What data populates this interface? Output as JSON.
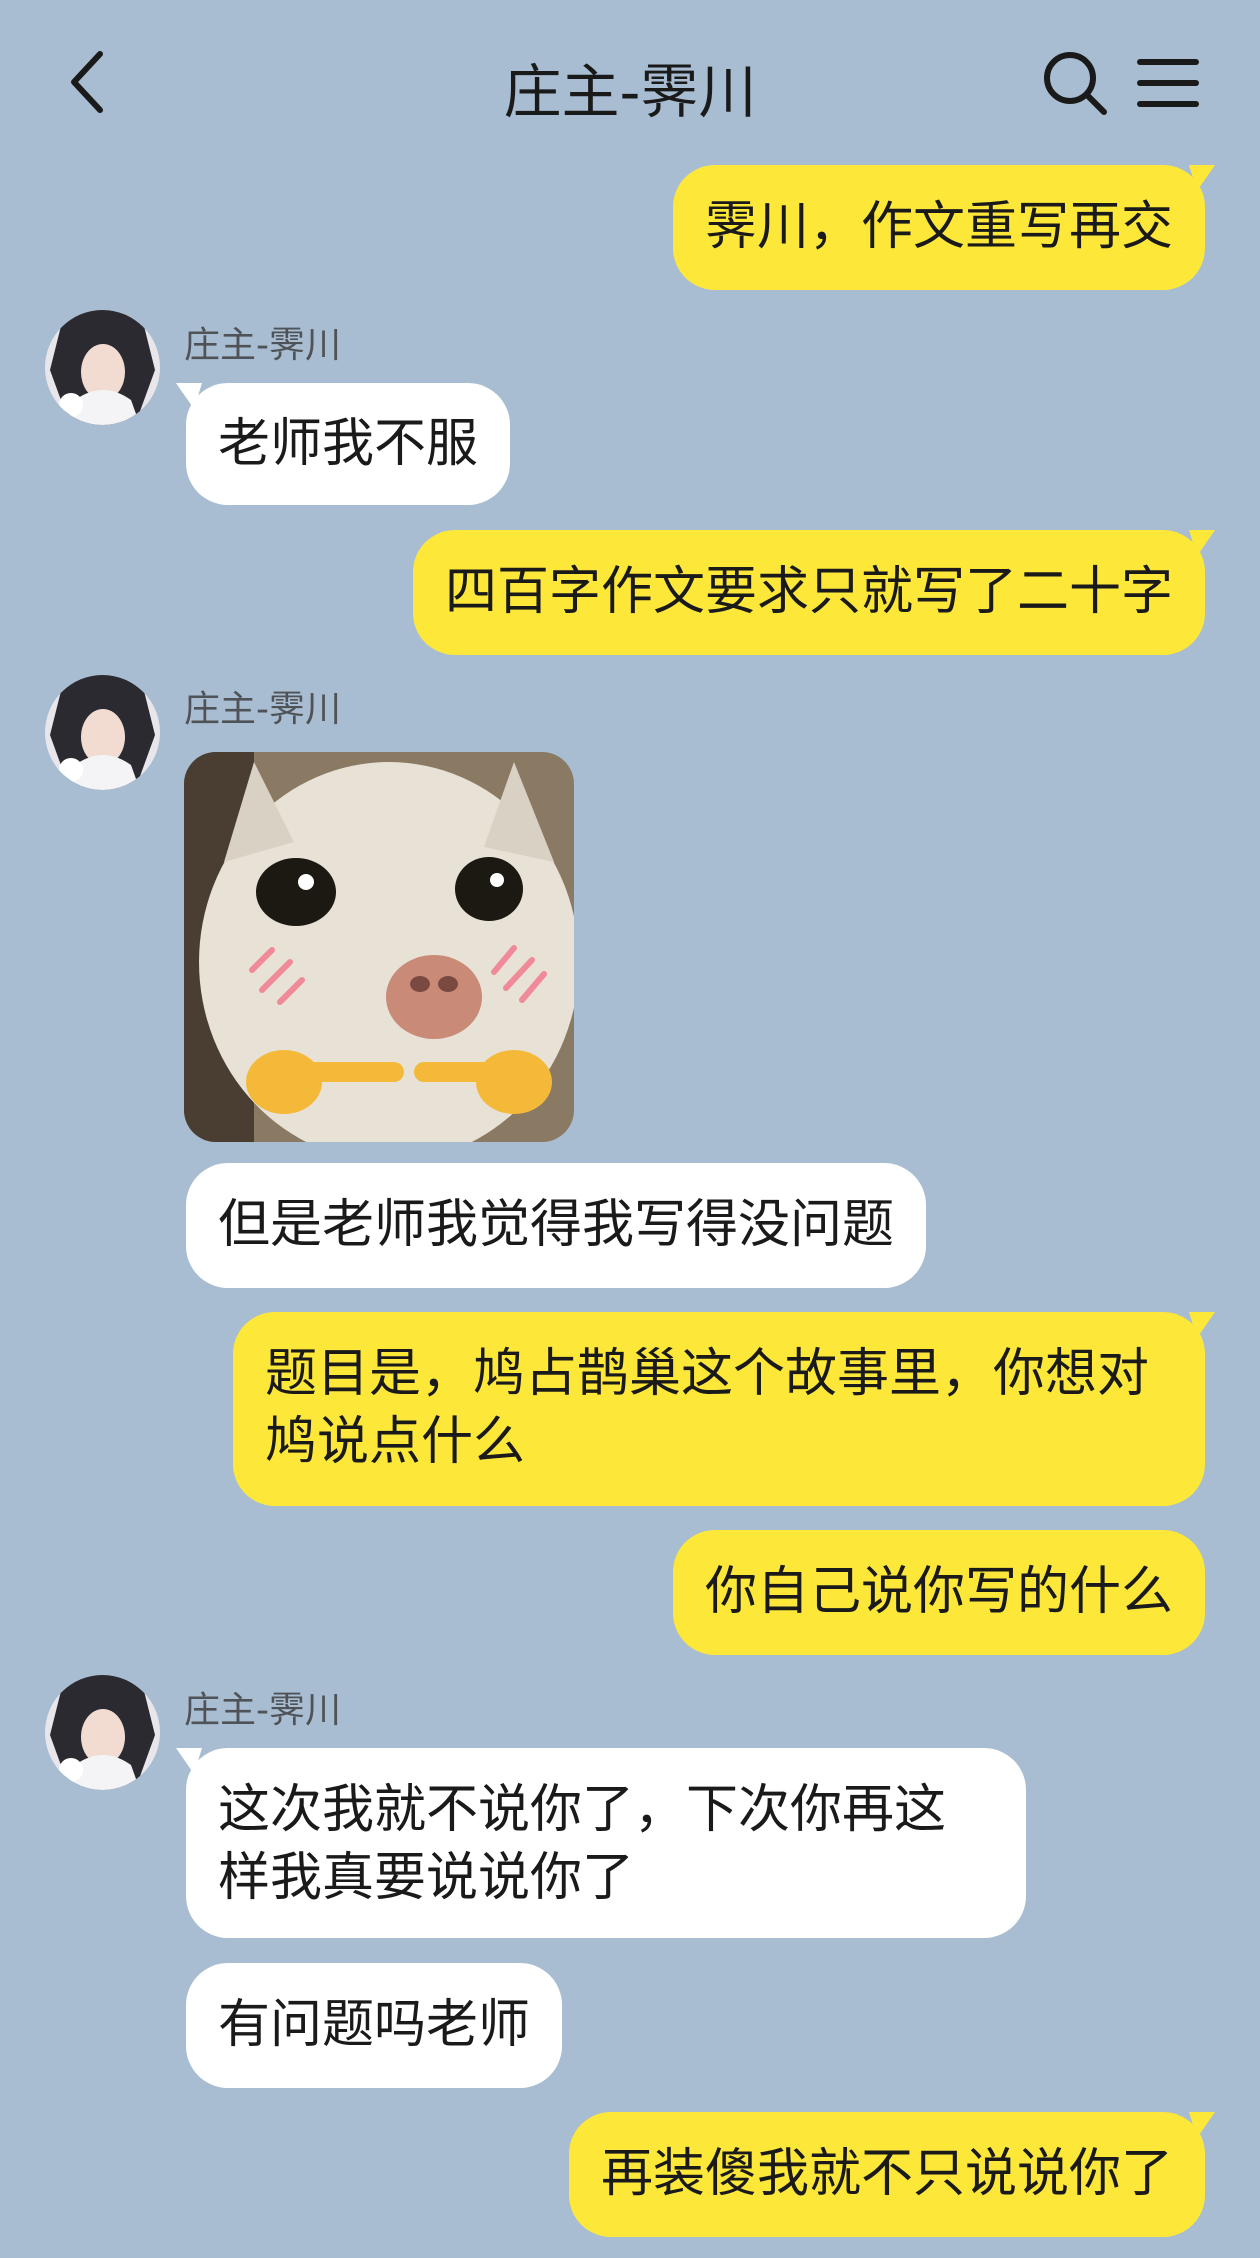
{
  "header": {
    "title": "庄主-霁川"
  },
  "icons": {
    "back": "chevron-left-icon",
    "search": "search-icon",
    "menu": "menu-icon"
  },
  "colors": {
    "background": "#a8bdd1",
    "self_bubble": "#fde83a",
    "other_bubble": "#ffffff"
  },
  "messages": [
    {
      "side": "right",
      "text": "霁川，作文重写再交"
    },
    {
      "side": "left",
      "sender": "庄主-霁川",
      "text": "老师我不服"
    },
    {
      "side": "right",
      "text": "四百字作文要求只就写了二十字"
    },
    {
      "side": "left",
      "sender": "庄主-霁川",
      "type": "image",
      "alt": "cat-pointing-fingers-sticker"
    },
    {
      "side": "left",
      "text": "但是老师我觉得我写得没问题"
    },
    {
      "side": "right",
      "text": "题目是，鸠占鹊巢这个故事里，你想对鸠说点什么"
    },
    {
      "side": "right",
      "text": "你自己说你写的什么"
    },
    {
      "side": "left",
      "sender": "庄主-霁川",
      "text": "这次我就不说你了，下次你再这样我真要说说你了"
    },
    {
      "side": "left",
      "text": "有问题吗老师"
    },
    {
      "side": "right",
      "text": "再装傻我就不只说说你了"
    }
  ]
}
